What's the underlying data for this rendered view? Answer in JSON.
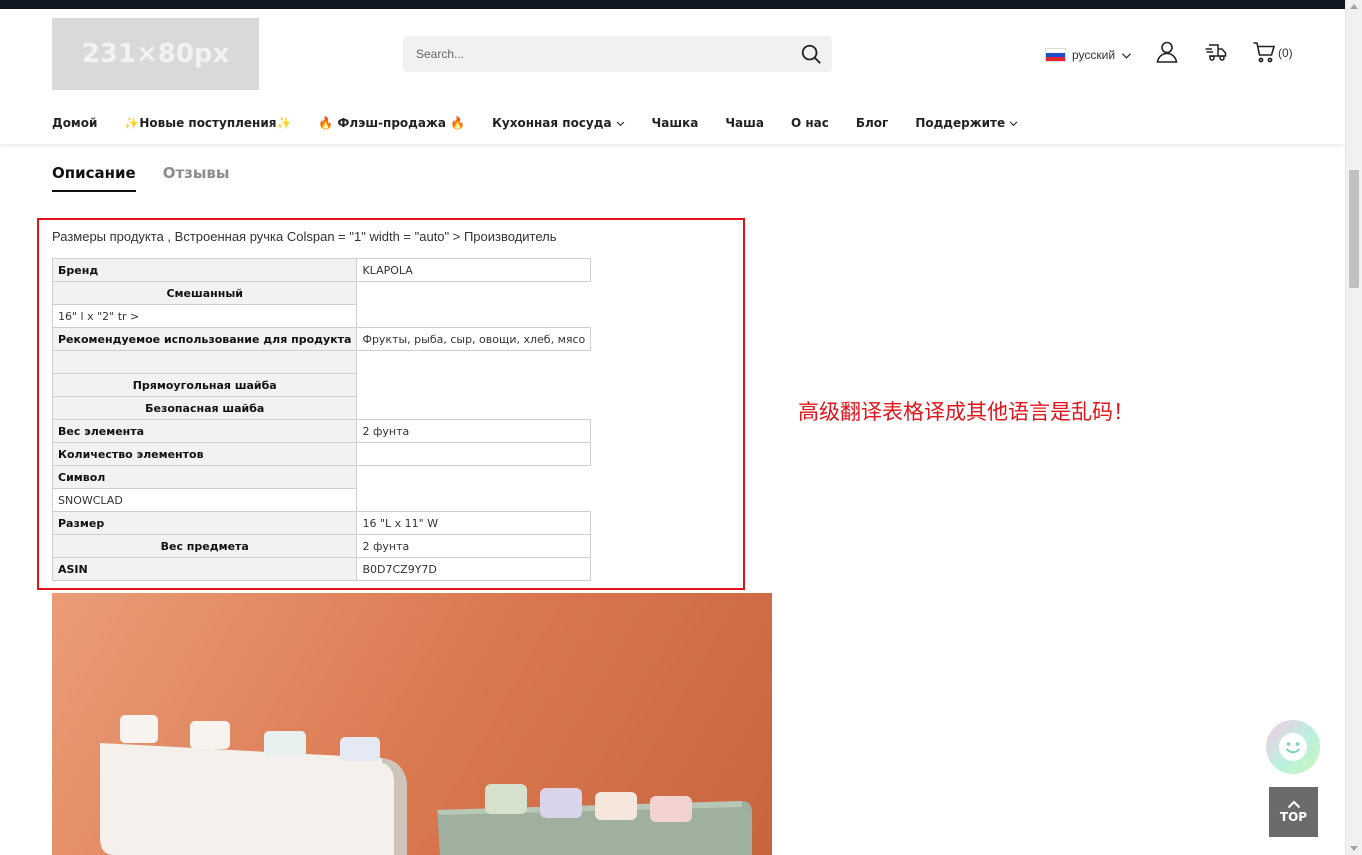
{
  "header": {
    "logo_text": "231×80px",
    "search": {
      "placeholder": "Search..."
    },
    "language": {
      "label": "русский",
      "flag_colors": [
        "#ffffff",
        "#1f4fd1",
        "#e3262e"
      ]
    },
    "cart_count": "(0)",
    "icons": [
      "search-icon",
      "chevron-down-icon",
      "user-icon",
      "truck-icon",
      "cart-icon"
    ]
  },
  "nav": {
    "items": [
      {
        "label": "Домой",
        "has_dropdown": false
      },
      {
        "label": "✨Новые поступления✨",
        "has_dropdown": false
      },
      {
        "label": "🔥 Флэш-продажа 🔥",
        "has_dropdown": false
      },
      {
        "label": "Кухонная посуда",
        "has_dropdown": true
      },
      {
        "label": "Чашка",
        "has_dropdown": false
      },
      {
        "label": "Чаша",
        "has_dropdown": false
      },
      {
        "label": "О нас",
        "has_dropdown": false
      },
      {
        "label": "Блог",
        "has_dropdown": false
      },
      {
        "label": "Поддержите",
        "has_dropdown": true
      }
    ]
  },
  "tabs": [
    {
      "label": "Описание",
      "active": true
    },
    {
      "label": "Отзывы",
      "active": false
    }
  ],
  "description": {
    "intro": "Размеры продукта , Встроенная ручка Colspan = \"1\" width = \"auto\" > Производитель",
    "rows": [
      {
        "key": "Бренд",
        "value": "KLAPOLA"
      },
      {
        "key": "Смешанный",
        "value": null
      },
      {
        "key": "16\" l x \"2\" tr >",
        "value": null
      },
      {
        "key": "Рекомендуемое использование для продукта",
        "value": "Фрукты, рыба, сыр, овощи, хлеб, мясо"
      },
      {
        "key": "",
        "value": null
      },
      {
        "key": "Прямоугольная шайба",
        "value": null
      },
      {
        "key": "Безопасная шайба",
        "value": null
      },
      {
        "key": "Вес элемента",
        "value": "2 фунта"
      },
      {
        "key": "Количество элементов",
        "value": ""
      },
      {
        "key": "Символ",
        "value": null
      },
      {
        "key": "SNOWCLAD",
        "value": null
      },
      {
        "key": "Размер",
        "value": "16 \"L x 11\" W"
      },
      {
        "key": "Вес предмета",
        "value": "2 фунта"
      },
      {
        "key": "ASIN",
        "value": "B0D7CZ9Y7D"
      }
    ]
  },
  "annotation": {
    "text": "高级翻译表格译成其他语言是乱码！",
    "color": "#e1141b"
  },
  "floating": {
    "chat_icon": "chat-smiley-icon",
    "top_label": "TOP"
  }
}
